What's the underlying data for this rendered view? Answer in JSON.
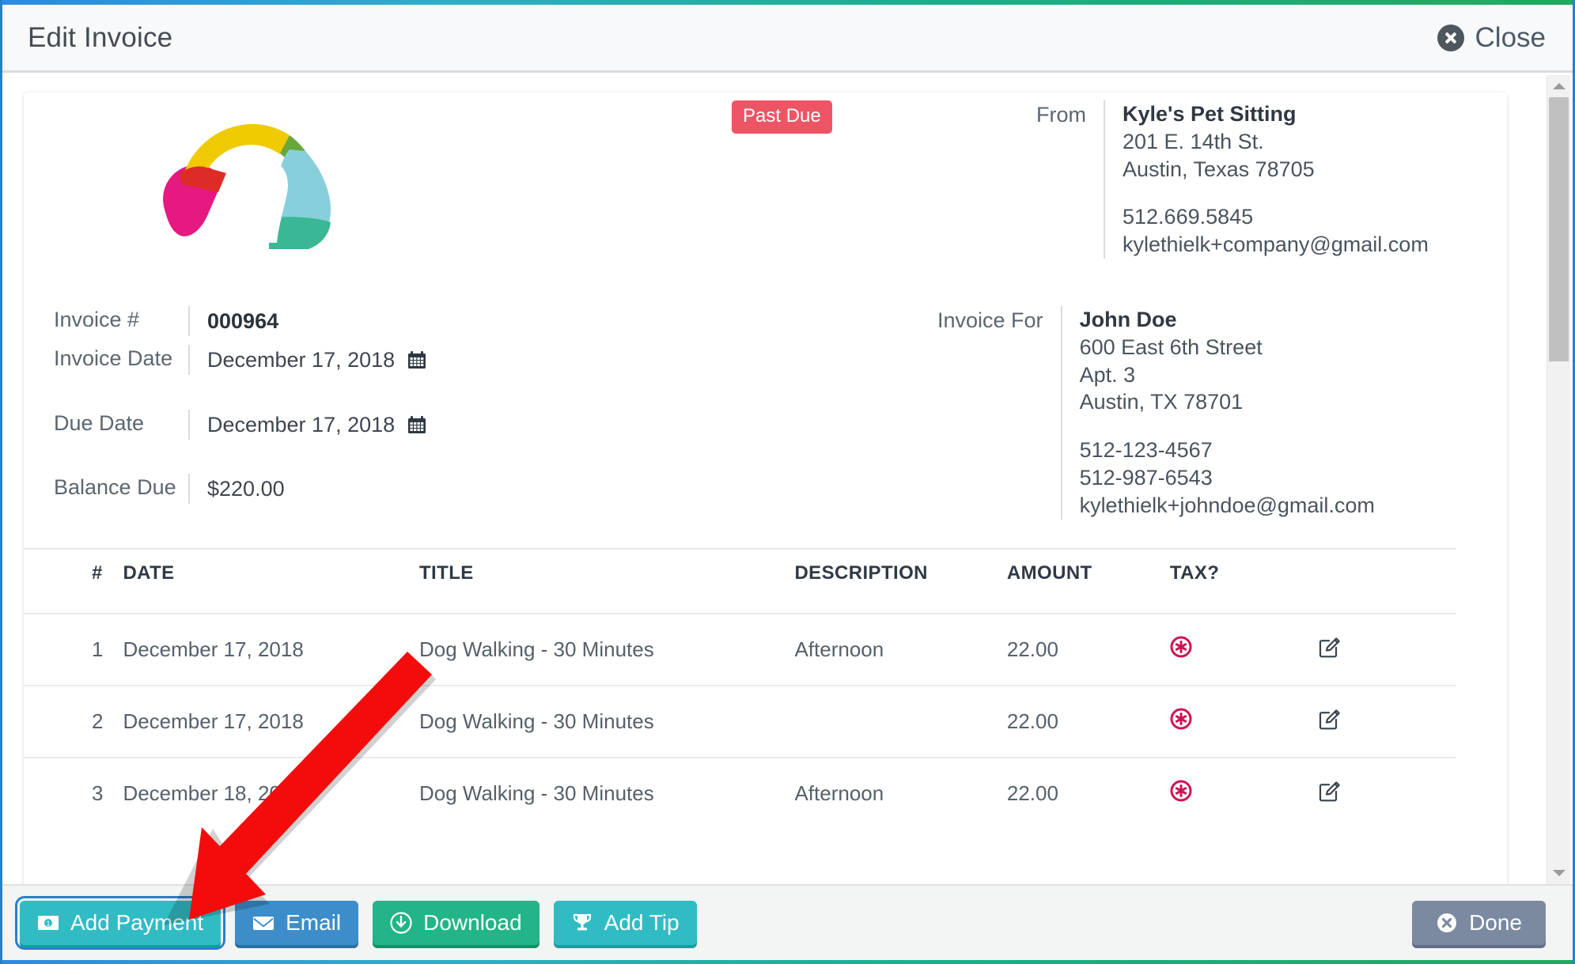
{
  "window": {
    "accent_gradient_start": "#2e8ae0",
    "accent_gradient_end": "#1faa5c",
    "border_color": "#2a7fc9"
  },
  "header": {
    "title": "Edit Invoice",
    "close_label": "Close",
    "close_icon": "circle-x-icon"
  },
  "invoice": {
    "status_badge": "Past Due",
    "status_badge_color": "#ed5565",
    "logo_icon": "pet-sitting-logo",
    "from": {
      "label": "From",
      "name": "Kyle's Pet Sitting",
      "address_line1": "201 E. 14th St.",
      "address_line2": "Austin, Texas 78705",
      "phone": "512.669.5845",
      "email": "kylethielk+company@gmail.com"
    },
    "bill_to": {
      "label": "Invoice For",
      "name": "John Doe",
      "address_line1": "600 East 6th Street",
      "address_line2": "Apt. 3",
      "address_line3": "Austin, TX 78701",
      "phone1": "512-123-4567",
      "phone2": "512-987-6543",
      "email": "kylethielk+johndoe@gmail.com"
    },
    "meta": {
      "invoice_number_label": "Invoice #",
      "invoice_number": "000964",
      "invoice_date_label": "Invoice Date",
      "invoice_date": "December 17, 2018",
      "due_date_label": "Due Date",
      "due_date": "December 17, 2018",
      "balance_due_label": "Balance Due",
      "balance_due": "$220.00",
      "calendar_icon": "calendar-icon"
    }
  },
  "table": {
    "columns": [
      "#",
      "DATE",
      "TITLE",
      "DESCRIPTION",
      "AMOUNT",
      "TAX?",
      ""
    ],
    "rows": [
      {
        "num": "1",
        "date": "December 17, 2018",
        "title": "Dog Walking - 30 Minutes",
        "description": "Afternoon",
        "amount": "22.00",
        "tax_icon": "circle-x-taxable-icon",
        "edit_icon": "edit-pencil-icon"
      },
      {
        "num": "2",
        "date": "December 17, 2018",
        "title": "Dog Walking - 30 Minutes",
        "description": "",
        "amount": "22.00",
        "tax_icon": "circle-x-taxable-icon",
        "edit_icon": "edit-pencil-icon"
      },
      {
        "num": "3",
        "date": "December 18, 2018",
        "title": "Dog Walking - 30 Minutes",
        "description": "Afternoon",
        "amount": "22.00",
        "tax_icon": "circle-x-taxable-icon",
        "edit_icon": "edit-pencil-icon"
      }
    ]
  },
  "footer": {
    "add_payment_label": "Add Payment",
    "add_payment_icon": "money-bill-icon",
    "email_label": "Email",
    "email_icon": "envelope-icon",
    "download_label": "Download",
    "download_icon": "download-circle-icon",
    "add_tip_label": "Add Tip",
    "add_tip_icon": "trophy-icon",
    "done_label": "Done",
    "done_icon": "circle-x-icon"
  },
  "annotation": {
    "arrow_color": "#f40b0b",
    "arrow_from": "table-date-header",
    "arrow_to": "add-payment-button"
  },
  "scrollbar": {
    "up_icon": "caret-up-icon",
    "down_icon": "caret-down-icon"
  }
}
